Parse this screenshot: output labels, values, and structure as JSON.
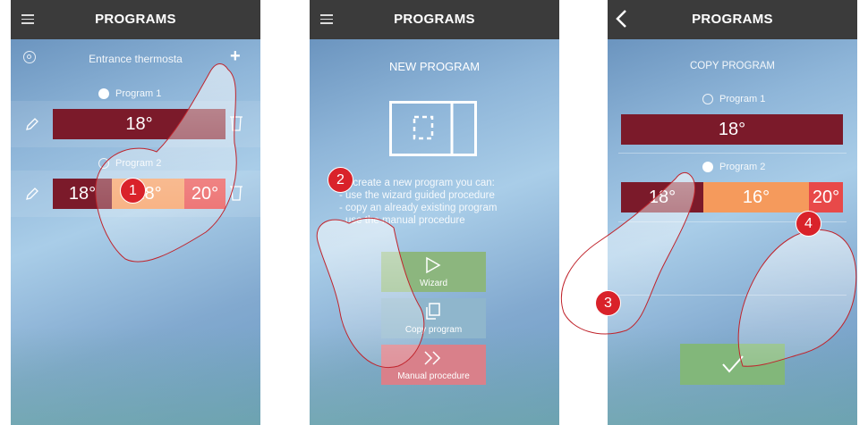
{
  "screen1": {
    "title": "PROGRAMS",
    "device_name": "Entrance thermosta",
    "add_symbol": "+",
    "programs": [
      {
        "name": "Program 1",
        "selected": true,
        "segments": [
          "18°"
        ]
      },
      {
        "name": "Program 2",
        "selected": false,
        "segments": [
          "18°",
          "18°",
          "20°"
        ]
      }
    ]
  },
  "screen2": {
    "title": "PROGRAMS",
    "heading": "NEW PROGRAM",
    "instructions": [
      "To create a new program you can:",
      "- use the wizard guided procedure",
      "- copy an already existing program",
      "- use the manual procedure"
    ],
    "buttons": {
      "wizard": "Wizard",
      "copy": "Copy program",
      "manual": "Manual procedure"
    }
  },
  "screen3": {
    "title": "PROGRAMS",
    "heading": "COPY PROGRAM",
    "programs": [
      {
        "name": "Program 1",
        "selected": false,
        "segments": [
          "18°"
        ]
      },
      {
        "name": "Program 2",
        "selected": true,
        "segments": [
          "18°",
          "16°",
          "20°"
        ]
      }
    ]
  },
  "markers": [
    "1",
    "2",
    "3",
    "4"
  ],
  "icons": [
    "menu-icon",
    "settings-icon",
    "plus-icon",
    "pencil-icon",
    "trash-icon",
    "device-icon",
    "play-icon",
    "copy-icon",
    "double-chevron-icon",
    "back-icon",
    "check-icon"
  ],
  "colors": {
    "topbar": "#3b3b3b",
    "temp_dark": "#7b1a2a",
    "temp_orange": "#f59a5c",
    "temp_red": "#e84949",
    "marker": "#d9222a",
    "wizard_btn": "#8cb67e",
    "copy_btn": "#8fb6cc",
    "manual_btn": "#d9808a",
    "confirm_btn": "#82b77a"
  }
}
